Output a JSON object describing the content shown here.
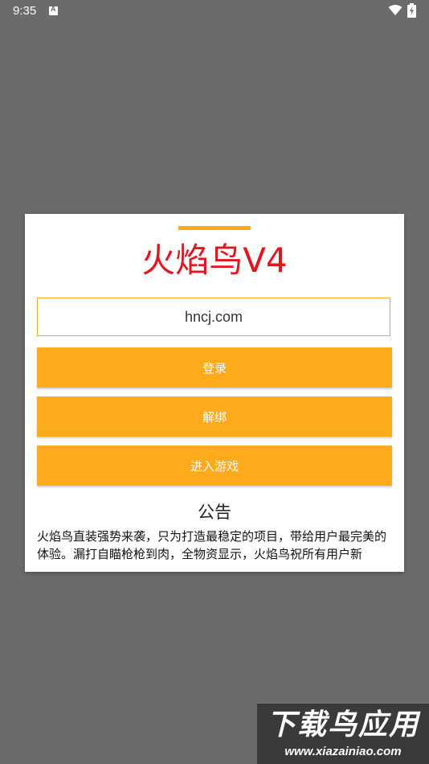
{
  "status_bar": {
    "time": "9:35",
    "notification_icon_letter": "A"
  },
  "dialog": {
    "title": "火焰鸟V4",
    "accent_color": "#fdaa1d",
    "title_color": "#e3161f",
    "input": {
      "value": "hncj.com"
    },
    "buttons": {
      "login": "登录",
      "unbind": "解绑",
      "enter_game": "进入游戏"
    },
    "notice": {
      "title": "公告",
      "text": "火焰鸟直装强势来袭，只为打造最稳定的项目，带给用户最完美的体验。漏打自瞄枪枪到肉，全物资显示，火焰鸟祝所有用户新"
    }
  },
  "watermark": {
    "title": "下载鸟应用",
    "url": "www.xiazainiao.com"
  }
}
